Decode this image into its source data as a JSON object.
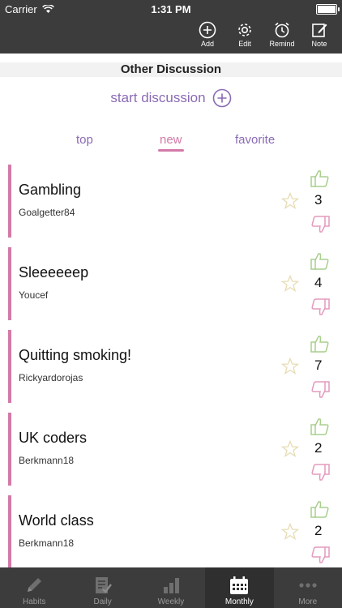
{
  "status": {
    "carrier": "Carrier",
    "time": "1:31 PM"
  },
  "toolbar": {
    "actions": [
      {
        "label": "Add",
        "icon": "plus-circle-icon"
      },
      {
        "label": "Edit",
        "icon": "gear-icon"
      },
      {
        "label": "Remind",
        "icon": "alarm-clock-icon"
      },
      {
        "label": "Note",
        "icon": "note-edit-icon"
      }
    ]
  },
  "section": {
    "title": "Other Discussion"
  },
  "start": {
    "label": "start discussion"
  },
  "filters": {
    "tabs": [
      "top",
      "new",
      "favorite"
    ],
    "active": "new"
  },
  "discussions": [
    {
      "title": "Gambling",
      "author": "Goalgetter84",
      "score": "3"
    },
    {
      "title": "Sleeeeeep",
      "author": "Youcef",
      "score": "4"
    },
    {
      "title": "Quitting smoking!",
      "author": "Rickyardorojas",
      "score": "7"
    },
    {
      "title": "UK coders",
      "author": "Berkmann18",
      "score": "2"
    },
    {
      "title": "World class",
      "author": "Berkmann18",
      "score": "2"
    }
  ],
  "tabbar": {
    "items": [
      "Habits",
      "Daily",
      "Weekly",
      "Monthly",
      "More"
    ],
    "active": "Monthly"
  },
  "colors": {
    "accent": "#d37aa8",
    "purple": "#8a6ab5",
    "bar": "#3c3c3c",
    "thumb_up": "#a8cf8e",
    "thumb_down": "#e39bbd"
  }
}
